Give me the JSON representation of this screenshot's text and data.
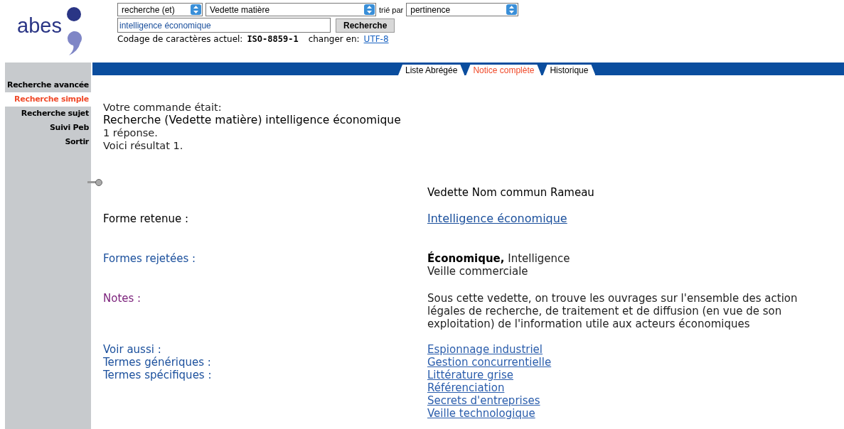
{
  "logo": {
    "text": "abes"
  },
  "search": {
    "operator": "recherche (et)",
    "index": "Vedette matière",
    "sort_label": "trié par",
    "sort": "pertinence",
    "query": "intelligence économique",
    "button": "Recherche"
  },
  "encoding": {
    "label": "Codage de caractères actuel:",
    "current": "ISO-8859-1",
    "change_label": "changer en:",
    "change_link": "UTF-8"
  },
  "tabs": [
    {
      "label": "Liste Abrégée",
      "selected": false
    },
    {
      "label": "Notice complète",
      "selected": true
    },
    {
      "label": "Historique",
      "selected": false
    }
  ],
  "sidebar": {
    "items": [
      {
        "label": "Recherche avancée",
        "selected": false
      },
      {
        "label": "Recherche simple",
        "selected": true
      },
      {
        "label": "Recherche sujet",
        "selected": false
      },
      {
        "label": "Suivi Peb",
        "selected": false
      },
      {
        "label": "Sortir",
        "selected": false
      }
    ]
  },
  "command": {
    "intro": "Votre commande était:",
    "query": "Recherche (Vedette matière) intelligence économique",
    "count": "1 réponse.",
    "result": "Voici résultat 1."
  },
  "record": {
    "type": "Vedette Nom commun Rameau",
    "fields": [
      {
        "kind": "link",
        "label": "Forme retenue :",
        "color": "#000000",
        "values": [
          "Intelligence économique"
        ]
      },
      {
        "kind": "text",
        "label": "Formes rejetées :",
        "color": "#1a4f9c",
        "values": [
          "**Économique,** Intelligence",
          "Veille commerciale"
        ]
      },
      {
        "kind": "text",
        "label": "Notes :",
        "color": "#7a1f7a",
        "values": [
          "Sous cette vedette, on trouve les ouvrages sur l'ensemble des action\nlégales de recherche, de traitement et de diffusion (en vue de son\nexploitation) de l'information utile aux acteurs économiques"
        ]
      }
    ],
    "see_also": {
      "labels": [
        "Voir aussi :",
        "Termes génériques :",
        "Termes spécifiques :"
      ],
      "links": [
        "Espionnage industriel",
        "Gestion concurrentielle",
        "Littérature grise",
        "Référenciation",
        "Secrets d'entreprises",
        "Veille technologique"
      ]
    }
  }
}
